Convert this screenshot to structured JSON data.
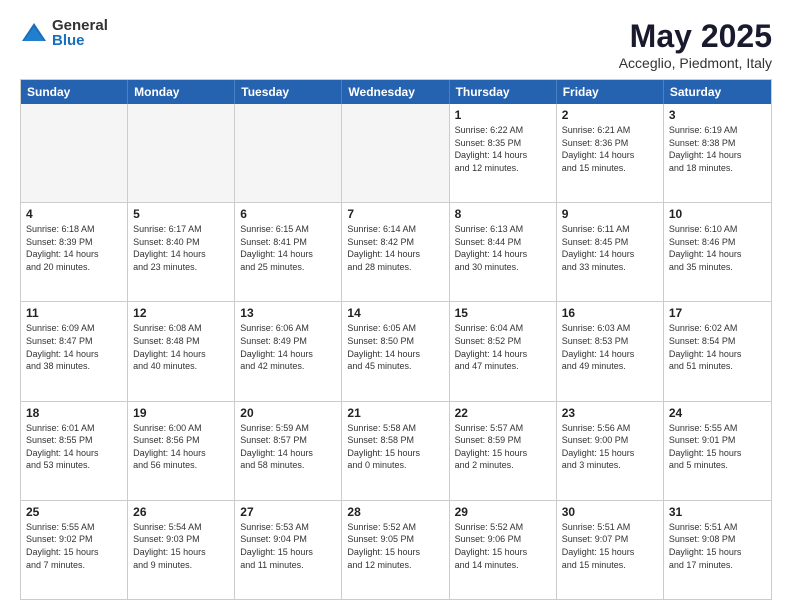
{
  "header": {
    "logo_general": "General",
    "logo_blue": "Blue",
    "month_title": "May 2025",
    "location": "Acceglio, Piedmont, Italy"
  },
  "days_of_week": [
    "Sunday",
    "Monday",
    "Tuesday",
    "Wednesday",
    "Thursday",
    "Friday",
    "Saturday"
  ],
  "weeks": [
    [
      {
        "day": "",
        "empty": true,
        "lines": []
      },
      {
        "day": "",
        "empty": true,
        "lines": []
      },
      {
        "day": "",
        "empty": true,
        "lines": []
      },
      {
        "day": "",
        "empty": true,
        "lines": []
      },
      {
        "day": "1",
        "empty": false,
        "lines": [
          "Sunrise: 6:22 AM",
          "Sunset: 8:35 PM",
          "Daylight: 14 hours",
          "and 12 minutes."
        ]
      },
      {
        "day": "2",
        "empty": false,
        "lines": [
          "Sunrise: 6:21 AM",
          "Sunset: 8:36 PM",
          "Daylight: 14 hours",
          "and 15 minutes."
        ]
      },
      {
        "day": "3",
        "empty": false,
        "lines": [
          "Sunrise: 6:19 AM",
          "Sunset: 8:38 PM",
          "Daylight: 14 hours",
          "and 18 minutes."
        ]
      }
    ],
    [
      {
        "day": "4",
        "empty": false,
        "lines": [
          "Sunrise: 6:18 AM",
          "Sunset: 8:39 PM",
          "Daylight: 14 hours",
          "and 20 minutes."
        ]
      },
      {
        "day": "5",
        "empty": false,
        "lines": [
          "Sunrise: 6:17 AM",
          "Sunset: 8:40 PM",
          "Daylight: 14 hours",
          "and 23 minutes."
        ]
      },
      {
        "day": "6",
        "empty": false,
        "lines": [
          "Sunrise: 6:15 AM",
          "Sunset: 8:41 PM",
          "Daylight: 14 hours",
          "and 25 minutes."
        ]
      },
      {
        "day": "7",
        "empty": false,
        "lines": [
          "Sunrise: 6:14 AM",
          "Sunset: 8:42 PM",
          "Daylight: 14 hours",
          "and 28 minutes."
        ]
      },
      {
        "day": "8",
        "empty": false,
        "lines": [
          "Sunrise: 6:13 AM",
          "Sunset: 8:44 PM",
          "Daylight: 14 hours",
          "and 30 minutes."
        ]
      },
      {
        "day": "9",
        "empty": false,
        "lines": [
          "Sunrise: 6:11 AM",
          "Sunset: 8:45 PM",
          "Daylight: 14 hours",
          "and 33 minutes."
        ]
      },
      {
        "day": "10",
        "empty": false,
        "lines": [
          "Sunrise: 6:10 AM",
          "Sunset: 8:46 PM",
          "Daylight: 14 hours",
          "and 35 minutes."
        ]
      }
    ],
    [
      {
        "day": "11",
        "empty": false,
        "lines": [
          "Sunrise: 6:09 AM",
          "Sunset: 8:47 PM",
          "Daylight: 14 hours",
          "and 38 minutes."
        ]
      },
      {
        "day": "12",
        "empty": false,
        "lines": [
          "Sunrise: 6:08 AM",
          "Sunset: 8:48 PM",
          "Daylight: 14 hours",
          "and 40 minutes."
        ]
      },
      {
        "day": "13",
        "empty": false,
        "lines": [
          "Sunrise: 6:06 AM",
          "Sunset: 8:49 PM",
          "Daylight: 14 hours",
          "and 42 minutes."
        ]
      },
      {
        "day": "14",
        "empty": false,
        "lines": [
          "Sunrise: 6:05 AM",
          "Sunset: 8:50 PM",
          "Daylight: 14 hours",
          "and 45 minutes."
        ]
      },
      {
        "day": "15",
        "empty": false,
        "lines": [
          "Sunrise: 6:04 AM",
          "Sunset: 8:52 PM",
          "Daylight: 14 hours",
          "and 47 minutes."
        ]
      },
      {
        "day": "16",
        "empty": false,
        "lines": [
          "Sunrise: 6:03 AM",
          "Sunset: 8:53 PM",
          "Daylight: 14 hours",
          "and 49 minutes."
        ]
      },
      {
        "day": "17",
        "empty": false,
        "lines": [
          "Sunrise: 6:02 AM",
          "Sunset: 8:54 PM",
          "Daylight: 14 hours",
          "and 51 minutes."
        ]
      }
    ],
    [
      {
        "day": "18",
        "empty": false,
        "lines": [
          "Sunrise: 6:01 AM",
          "Sunset: 8:55 PM",
          "Daylight: 14 hours",
          "and 53 minutes."
        ]
      },
      {
        "day": "19",
        "empty": false,
        "lines": [
          "Sunrise: 6:00 AM",
          "Sunset: 8:56 PM",
          "Daylight: 14 hours",
          "and 56 minutes."
        ]
      },
      {
        "day": "20",
        "empty": false,
        "lines": [
          "Sunrise: 5:59 AM",
          "Sunset: 8:57 PM",
          "Daylight: 14 hours",
          "and 58 minutes."
        ]
      },
      {
        "day": "21",
        "empty": false,
        "lines": [
          "Sunrise: 5:58 AM",
          "Sunset: 8:58 PM",
          "Daylight: 15 hours",
          "and 0 minutes."
        ]
      },
      {
        "day": "22",
        "empty": false,
        "lines": [
          "Sunrise: 5:57 AM",
          "Sunset: 8:59 PM",
          "Daylight: 15 hours",
          "and 2 minutes."
        ]
      },
      {
        "day": "23",
        "empty": false,
        "lines": [
          "Sunrise: 5:56 AM",
          "Sunset: 9:00 PM",
          "Daylight: 15 hours",
          "and 3 minutes."
        ]
      },
      {
        "day": "24",
        "empty": false,
        "lines": [
          "Sunrise: 5:55 AM",
          "Sunset: 9:01 PM",
          "Daylight: 15 hours",
          "and 5 minutes."
        ]
      }
    ],
    [
      {
        "day": "25",
        "empty": false,
        "lines": [
          "Sunrise: 5:55 AM",
          "Sunset: 9:02 PM",
          "Daylight: 15 hours",
          "and 7 minutes."
        ]
      },
      {
        "day": "26",
        "empty": false,
        "lines": [
          "Sunrise: 5:54 AM",
          "Sunset: 9:03 PM",
          "Daylight: 15 hours",
          "and 9 minutes."
        ]
      },
      {
        "day": "27",
        "empty": false,
        "lines": [
          "Sunrise: 5:53 AM",
          "Sunset: 9:04 PM",
          "Daylight: 15 hours",
          "and 11 minutes."
        ]
      },
      {
        "day": "28",
        "empty": false,
        "lines": [
          "Sunrise: 5:52 AM",
          "Sunset: 9:05 PM",
          "Daylight: 15 hours",
          "and 12 minutes."
        ]
      },
      {
        "day": "29",
        "empty": false,
        "lines": [
          "Sunrise: 5:52 AM",
          "Sunset: 9:06 PM",
          "Daylight: 15 hours",
          "and 14 minutes."
        ]
      },
      {
        "day": "30",
        "empty": false,
        "lines": [
          "Sunrise: 5:51 AM",
          "Sunset: 9:07 PM",
          "Daylight: 15 hours",
          "and 15 minutes."
        ]
      },
      {
        "day": "31",
        "empty": false,
        "lines": [
          "Sunrise: 5:51 AM",
          "Sunset: 9:08 PM",
          "Daylight: 15 hours",
          "and 17 minutes."
        ]
      }
    ]
  ]
}
